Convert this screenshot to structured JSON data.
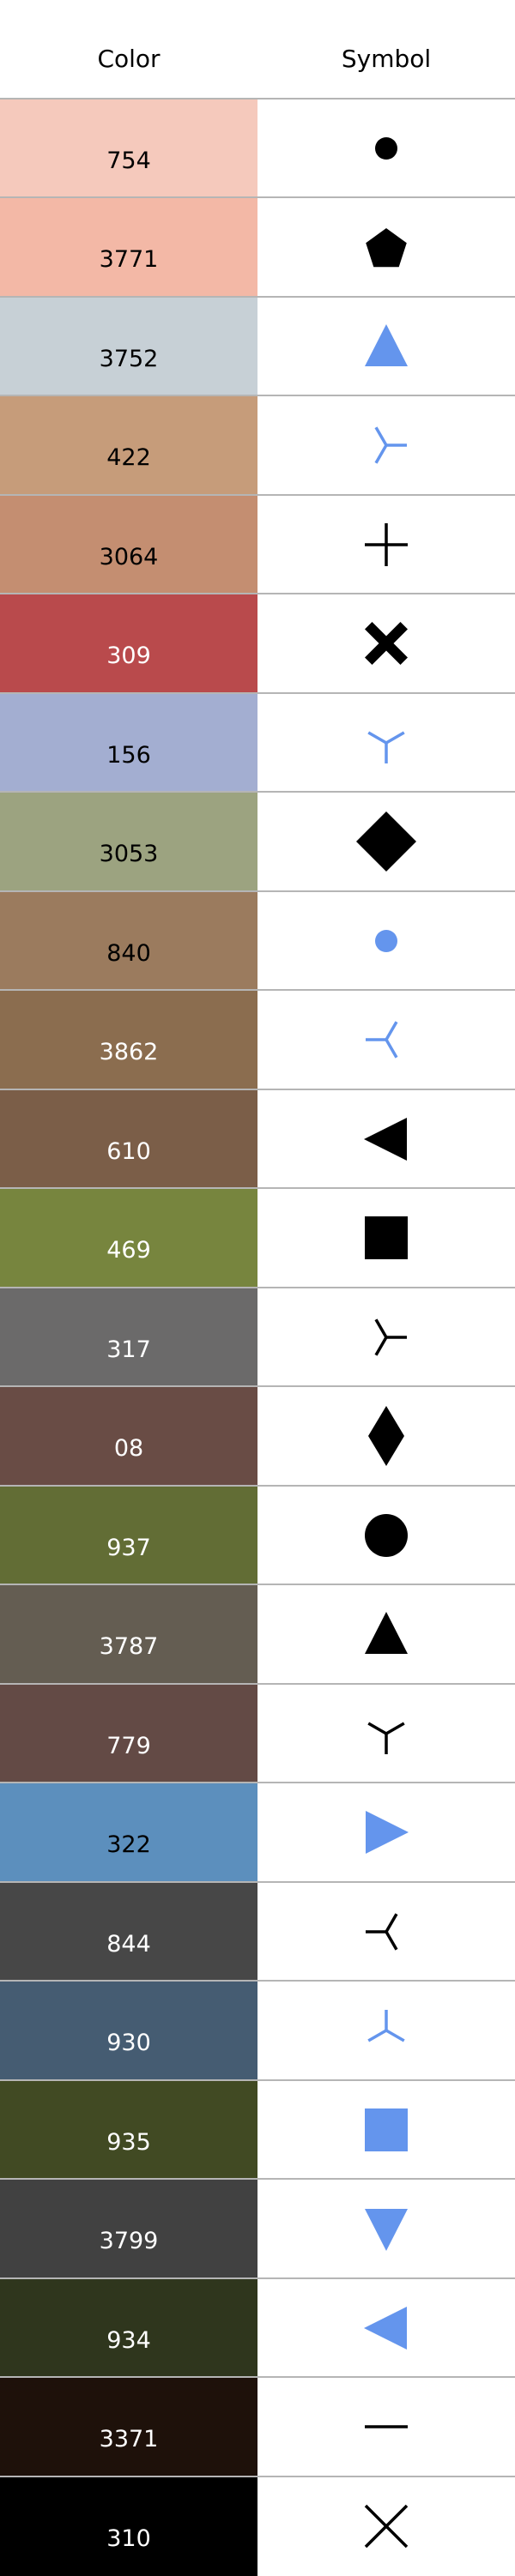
{
  "header": {
    "color_label": "Color",
    "symbol_label": "Symbol"
  },
  "rows": [
    {
      "label": "754",
      "color": "#F5C9BC",
      "text_color": "#000000",
      "symbol": "circle-small",
      "symbol_color": "#000000"
    },
    {
      "label": "3771",
      "color": "#F3B8A6",
      "text_color": "#000000",
      "symbol": "pentagon",
      "symbol_color": "#000000"
    },
    {
      "label": "3752",
      "color": "#C7D0D6",
      "text_color": "#000000",
      "symbol": "triangle-up",
      "symbol_color": "#6495ED"
    },
    {
      "label": "422",
      "color": "#C69C7A",
      "text_color": "#000000",
      "symbol": "tri-left",
      "symbol_color": "#6495ED"
    },
    {
      "label": "3064",
      "color": "#C48E71",
      "text_color": "#000000",
      "symbol": "plus",
      "symbol_color": "#000000"
    },
    {
      "label": "309",
      "color": "#B94A4C",
      "text_color": "#ffffff",
      "symbol": "x-filled",
      "symbol_color": "#000000"
    },
    {
      "label": "156",
      "color": "#A3AED1",
      "text_color": "#000000",
      "symbol": "tri-up",
      "symbol_color": "#6495ED"
    },
    {
      "label": "3053",
      "color": "#9CA380",
      "text_color": "#000000",
      "symbol": "diamond",
      "symbol_color": "#000000"
    },
    {
      "label": "840",
      "color": "#9B7B5E",
      "text_color": "#000000",
      "symbol": "circle-small",
      "symbol_color": "#6495ED"
    },
    {
      "label": "3862",
      "color": "#8B6D4F",
      "text_color": "#ffffff",
      "symbol": "tri-right",
      "symbol_color": "#6495ED"
    },
    {
      "label": "610",
      "color": "#7B5E48",
      "text_color": "#ffffff",
      "symbol": "triangle-left",
      "symbol_color": "#000000"
    },
    {
      "label": "469",
      "color": "#77853E",
      "text_color": "#ffffff",
      "symbol": "square",
      "symbol_color": "#000000"
    },
    {
      "label": "317",
      "color": "#6B6A6A",
      "text_color": "#ffffff",
      "symbol": "tri-left",
      "symbol_color": "#000000"
    },
    {
      "label": "08",
      "color": "#694C45",
      "text_color": "#ffffff",
      "symbol": "thin-diamond",
      "symbol_color": "#000000"
    },
    {
      "label": "937",
      "color": "#626D35",
      "text_color": "#ffffff",
      "symbol": "circle-large",
      "symbol_color": "#000000"
    },
    {
      "label": "3787",
      "color": "#645D52",
      "text_color": "#ffffff",
      "symbol": "triangle-up",
      "symbol_color": "#000000"
    },
    {
      "label": "779",
      "color": "#634A45",
      "text_color": "#ffffff",
      "symbol": "tri-up",
      "symbol_color": "#000000"
    },
    {
      "label": "322",
      "color": "#5C8FBD",
      "text_color": "#000000",
      "symbol": "triangle-right",
      "symbol_color": "#6495ED"
    },
    {
      "label": "844",
      "color": "#474747",
      "text_color": "#ffffff",
      "symbol": "tri-right",
      "symbol_color": "#000000"
    },
    {
      "label": "930",
      "color": "#455C72",
      "text_color": "#ffffff",
      "symbol": "tri-down",
      "symbol_color": "#6495ED"
    },
    {
      "label": "935",
      "color": "#414A23",
      "text_color": "#ffffff",
      "symbol": "square",
      "symbol_color": "#6495ED"
    },
    {
      "label": "3799",
      "color": "#414141",
      "text_color": "#ffffff",
      "symbol": "triangle-down",
      "symbol_color": "#6495ED"
    },
    {
      "label": "934",
      "color": "#2F361D",
      "text_color": "#ffffff",
      "symbol": "triangle-left",
      "symbol_color": "#6495ED"
    },
    {
      "label": "3371",
      "color": "#1E110A",
      "text_color": "#ffffff",
      "symbol": "hline",
      "symbol_color": "#000000"
    },
    {
      "label": "310",
      "color": "#000000",
      "text_color": "#ffffff",
      "symbol": "x",
      "symbol_color": "#000000"
    }
  ]
}
